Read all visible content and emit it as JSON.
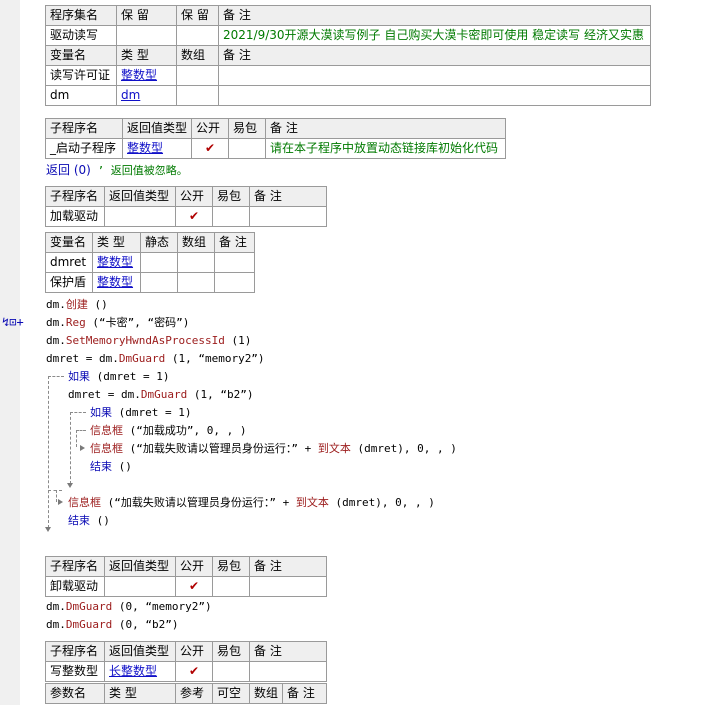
{
  "assembly_table": {
    "headers": [
      "程序集名",
      "保 留",
      "保 留",
      "备 注"
    ],
    "name": "驱动读写",
    "note": "2021/9/30开源大漠读写例子 自己购买大漠卡密即可使用 稳定读写 经济又实惠"
  },
  "var_table": {
    "headers": [
      "变量名",
      "类 型",
      "数组",
      "备 注"
    ],
    "rows": [
      {
        "name": "读写许可证",
        "type": "整数型"
      },
      {
        "name": "dm",
        "type": "dm"
      }
    ]
  },
  "startup_table": {
    "headers": [
      "子程序名",
      "返回值类型",
      "公开",
      "易包",
      "备 注"
    ],
    "name": "_启动子程序",
    "return_type": "整数型",
    "note": "请在本子程序中放置动态链接库初始化代码"
  },
  "startup_code": {
    "ret_kw": "返回",
    "ret_args": " (0)",
    "comment": "  ’ 返回值被忽略。"
  },
  "load_table": {
    "headers": [
      "子程序名",
      "返回值类型",
      "公开",
      "易包",
      "备 注"
    ],
    "name": "加载驱动"
  },
  "load_vars": {
    "headers": [
      "变量名",
      "类 型",
      "静态",
      "数组",
      "备 注"
    ],
    "rows": [
      {
        "name": "dmret",
        "type": "整数型"
      },
      {
        "name": "保护盾",
        "type": "整数型"
      }
    ]
  },
  "gutter": {
    "breakpoint": "↯⊡+"
  },
  "code": {
    "l1": {
      "a": "dm.",
      "b": "创建",
      "c": " ()"
    },
    "l2": {
      "a": "dm.",
      "b": "Reg",
      "c": " (“卡密”, “密码”)"
    },
    "l3": {
      "a": "dm.",
      "b": "SetMemoryHwndAsProcessId",
      "c": " (1)"
    },
    "l4": {
      "a": "dmret = dm.",
      "b": "DmGuard",
      "c": " (1, “memory2”)"
    },
    "l5": {
      "a": "如果",
      "c": " (dmret = 1)"
    },
    "l6": {
      "a": "dmret = dm.",
      "b": "DmGuard",
      "c": " (1, “b2”)"
    },
    "l7": {
      "a": "如果",
      "c": " (dmret = 1)"
    },
    "l8": {
      "a": "信息框",
      "c": " (“加载成功”, 0, , )"
    },
    "l9": {
      "a": "信息框",
      "c1": " (“加载失败请以管理员身份运行：” + ",
      "b": "到文本",
      "c2": " (dmret), 0, , )"
    },
    "l10": {
      "a": "结束",
      "c": " ()"
    },
    "l11": {
      "a": "信息框",
      "c1": " (“加载失败请以管理员身份运行：” + ",
      "b": "到文本",
      "c2": " (dmret), 0, , )"
    },
    "l12": {
      "a": "结束",
      "c": " ()"
    }
  },
  "unload_table": {
    "headers": [
      "子程序名",
      "返回值类型",
      "公开",
      "易包",
      "备 注"
    ],
    "name": "卸载驱动"
  },
  "unload_code": {
    "l1": {
      "a": "dm.",
      "b": "DmGuard",
      "c": " (0, “memory2”)"
    },
    "l2": {
      "a": "dm.",
      "b": "DmGuard",
      "c": " (0, “b2”)"
    }
  },
  "write_table": {
    "headers": [
      "子程序名",
      "返回值类型",
      "公开",
      "易包",
      "备 注"
    ],
    "name": "写整数型",
    "return_type": "长整数型"
  },
  "param_table": {
    "headers": [
      "参数名",
      "类 型",
      "参考",
      "可空",
      "数组",
      "备 注"
    ]
  },
  "check_glyph": "✔"
}
